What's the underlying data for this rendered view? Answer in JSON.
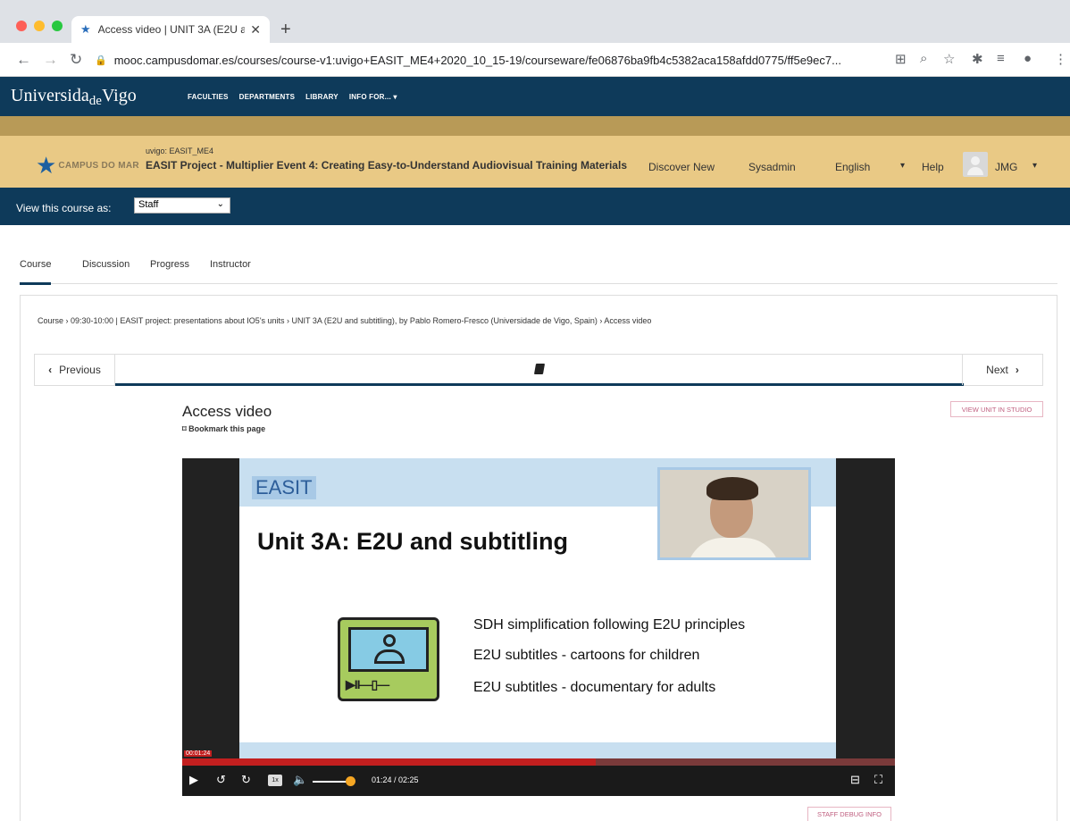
{
  "browser": {
    "tab_title": "Access video | UNIT 3A (E2U a",
    "url": "mooc.campusdomar.es/courses/course-v1:uvigo+EASIT_ME4+2020_10_15-19/courseware/fe06876ba9fb4c5382aca158afdd0775/ff5e9ec7..."
  },
  "university": {
    "logo_part1": "Universida",
    "logo_de": "de",
    "logo_part2": "Vigo",
    "nav": [
      "FACULTIES",
      "DEPARTMENTS",
      "LIBRARY",
      "INFO FOR... ▾"
    ]
  },
  "course_header": {
    "logo_text": "CAMPUS DO MAR",
    "course_id": "uvigo: EASIT_ME4",
    "course_name": "EASIT Project - Multiplier Event 4: Creating Easy-to-Understand Audiovisual Training Materials",
    "discover": "Discover New",
    "sysadmin": "Sysadmin",
    "language": "English",
    "help": "Help",
    "username": "JMG"
  },
  "staff_bar": {
    "label": "View this course as:",
    "selected": "Staff"
  },
  "course_tabs": [
    "Course",
    "Discussion",
    "Progress",
    "Instructor"
  ],
  "breadcrumb": "Course  ›  09:30-10:00 | EASIT project: presentations about IO5's units  ›  UNIT 3A (E2U and subtitling), by Pablo Romero-Fresco (Universidade de Vigo, Spain)  ›  Access video",
  "sequence": {
    "previous": "Previous",
    "next": "Next"
  },
  "unit": {
    "title": "Access video",
    "bookmark": "Bookmark this page",
    "studio_button": "VIEW UNIT IN STUDIO"
  },
  "video": {
    "slide_logo": "EASIT",
    "slide_title": "Unit 3A: E2U and subtitling",
    "bullets": [
      "SDH simplification following E2U principles",
      "E2U subtitles - cartoons for children",
      "E2U subtitles - documentary for adults"
    ],
    "current_time_tag": "00:01:24",
    "progress_fraction": 0.58,
    "speed": "1x",
    "time_display": "01:24 / 02:25"
  },
  "debug_button": "STAFF DEBUG INFO",
  "colors": {
    "uv_navy": "#0e3a5a",
    "course_gold": "#e9c985",
    "gold_strip": "#b89a57",
    "progress_red": "#c21f1f"
  }
}
